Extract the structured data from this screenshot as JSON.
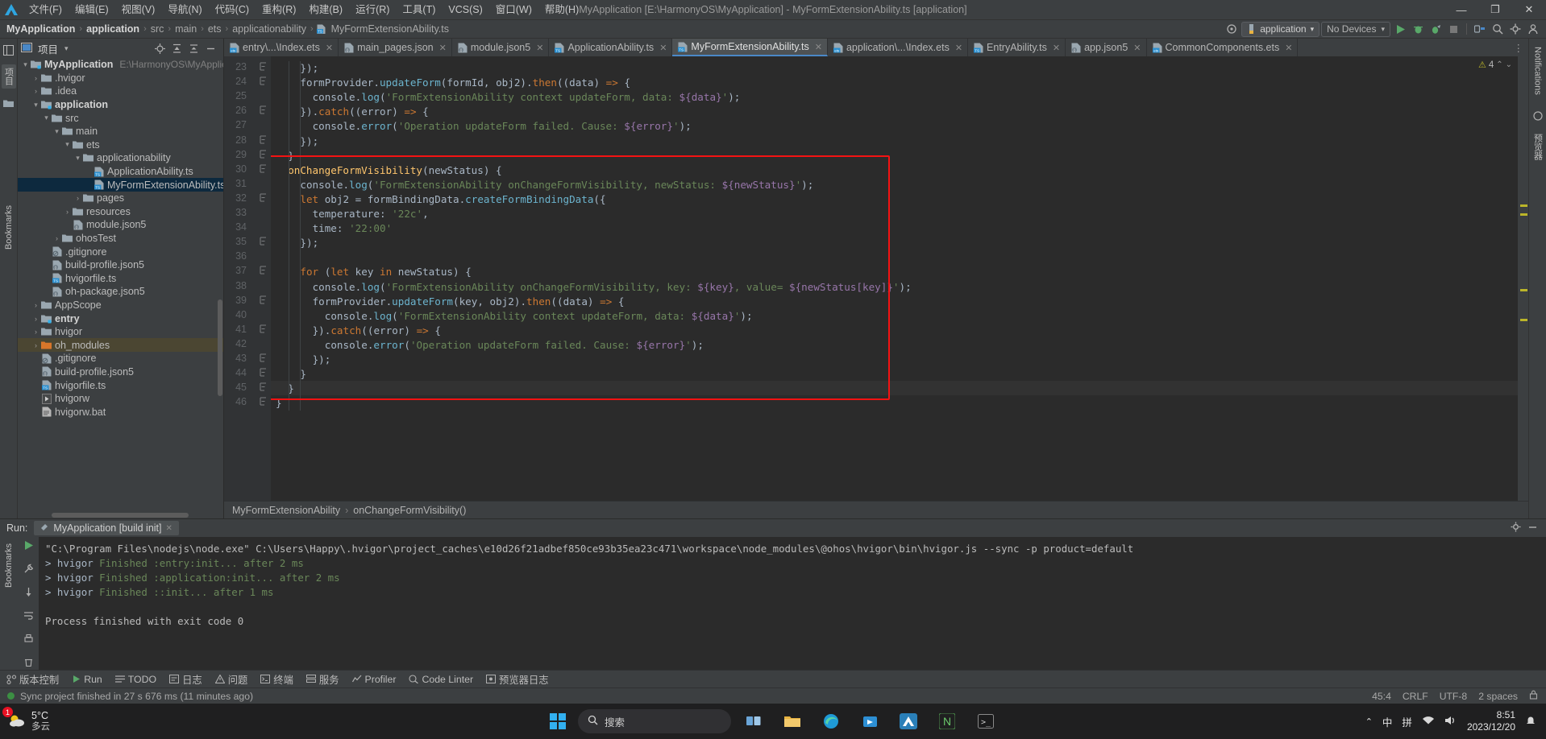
{
  "window": {
    "title": "MyApplication [E:\\HarmonyOS\\MyApplication] - MyFormExtensionAbility.ts [application]",
    "minimize": "—",
    "maximize": "❐",
    "close": "✕"
  },
  "menubar": {
    "items": [
      {
        "label": "文件(F)",
        "name": "menu-file"
      },
      {
        "label": "编辑(E)",
        "name": "menu-edit"
      },
      {
        "label": "视图(V)",
        "name": "menu-view"
      },
      {
        "label": "导航(N)",
        "name": "menu-navigate"
      },
      {
        "label": "代码(C)",
        "name": "menu-code"
      },
      {
        "label": "重构(R)",
        "name": "menu-refactor"
      },
      {
        "label": "构建(B)",
        "name": "menu-build"
      },
      {
        "label": "运行(R)",
        "name": "menu-run"
      },
      {
        "label": "工具(T)",
        "name": "menu-tools"
      },
      {
        "label": "VCS(S)",
        "name": "menu-vcs"
      },
      {
        "label": "窗口(W)",
        "name": "menu-window"
      },
      {
        "label": "帮助(H)",
        "name": "menu-help"
      }
    ]
  },
  "breadcrumb": {
    "items": [
      "MyApplication",
      "application",
      "src",
      "main",
      "ets",
      "applicationability",
      "MyFormExtensionAbility.ts"
    ],
    "separator": "›"
  },
  "navbar": {
    "run_config": "application",
    "device_selector": "No Devices",
    "caret_down": "▾"
  },
  "project_panel": {
    "title": "项目",
    "dropdown_caret": "▾",
    "tree": [
      {
        "depth": 0,
        "twisty": "▾",
        "icon": "module-folder",
        "label": "MyApplication",
        "bold": true,
        "path": "E:\\HarmonyOS\\MyApplication"
      },
      {
        "depth": 1,
        "twisty": "›",
        "icon": "folder",
        "label": ".hvigor"
      },
      {
        "depth": 1,
        "twisty": "›",
        "icon": "folder",
        "label": ".idea"
      },
      {
        "depth": 1,
        "twisty": "▾",
        "icon": "module-folder",
        "label": "application",
        "bold": true
      },
      {
        "depth": 2,
        "twisty": "▾",
        "icon": "folder",
        "label": "src"
      },
      {
        "depth": 3,
        "twisty": "▾",
        "icon": "folder",
        "label": "main"
      },
      {
        "depth": 4,
        "twisty": "▾",
        "icon": "folder",
        "label": "ets"
      },
      {
        "depth": 5,
        "twisty": "▾",
        "icon": "folder",
        "label": "applicationability"
      },
      {
        "depth": 6,
        "twisty": "",
        "icon": "ts-file",
        "label": "ApplicationAbility.ts"
      },
      {
        "depth": 6,
        "twisty": "",
        "icon": "ts-file",
        "label": "MyFormExtensionAbility.ts",
        "selected": true
      },
      {
        "depth": 5,
        "twisty": "›",
        "icon": "folder",
        "label": "pages"
      },
      {
        "depth": 4,
        "twisty": "›",
        "icon": "folder",
        "label": "resources"
      },
      {
        "depth": 4,
        "twisty": "",
        "icon": "json-file",
        "label": "module.json5"
      },
      {
        "depth": 3,
        "twisty": "›",
        "icon": "folder",
        "label": "ohosTest"
      },
      {
        "depth": 2,
        "twisty": "",
        "icon": "gitignore-file",
        "label": ".gitignore"
      },
      {
        "depth": 2,
        "twisty": "",
        "icon": "json-file",
        "label": "build-profile.json5"
      },
      {
        "depth": 2,
        "twisty": "",
        "icon": "ts-file",
        "label": "hvigorfile.ts"
      },
      {
        "depth": 2,
        "twisty": "",
        "icon": "json-file",
        "label": "oh-package.json5"
      },
      {
        "depth": 1,
        "twisty": "›",
        "icon": "folder",
        "label": "AppScope"
      },
      {
        "depth": 1,
        "twisty": "›",
        "icon": "module-folder",
        "label": "entry",
        "bold": true
      },
      {
        "depth": 1,
        "twisty": "›",
        "icon": "folder",
        "label": "hvigor"
      },
      {
        "depth": 1,
        "twisty": "›",
        "icon": "folder-orange",
        "label": "oh_modules",
        "highlight": true
      },
      {
        "depth": 1,
        "twisty": "",
        "icon": "gitignore-file",
        "label": ".gitignore"
      },
      {
        "depth": 1,
        "twisty": "",
        "icon": "json-file",
        "label": "build-profile.json5"
      },
      {
        "depth": 1,
        "twisty": "",
        "icon": "ts-file",
        "label": "hvigorfile.ts"
      },
      {
        "depth": 1,
        "twisty": "",
        "icon": "script-file",
        "label": "hvigorw"
      },
      {
        "depth": 1,
        "twisty": "",
        "icon": "bat-file",
        "label": "hvigorw.bat"
      }
    ]
  },
  "left_strip": {
    "project_tab": "项目",
    "structure_icon": "structure-icon",
    "folder_icon": "folder-icon",
    "bookmarks_tab": "Bookmarks"
  },
  "right_strip": {
    "notifications_tab": "Notifications",
    "preview_tab": "预览器"
  },
  "editor_tabs": [
    {
      "label": "entry\\...\\Index.ets",
      "icon": "ets-file",
      "active": false
    },
    {
      "label": "main_pages.json",
      "icon": "json-file",
      "active": false
    },
    {
      "label": "module.json5",
      "icon": "json-file",
      "active": false
    },
    {
      "label": "ApplicationAbility.ts",
      "icon": "ts-file",
      "active": false
    },
    {
      "label": "MyFormExtensionAbility.ts",
      "icon": "ts-file",
      "active": true
    },
    {
      "label": "application\\...\\Index.ets",
      "icon": "ets-file",
      "active": false
    },
    {
      "label": "EntryAbility.ts",
      "icon": "ts-file",
      "active": false
    },
    {
      "label": "app.json5",
      "icon": "json-file",
      "active": false
    },
    {
      "label": "CommonComponents.ets",
      "icon": "ets-file",
      "active": false
    }
  ],
  "editor": {
    "warning_count": "4",
    "warning_icon": "warning-triangle-icon",
    "first_line_number": 23,
    "lines": [
      {
        "n": 23,
        "fold": "minus",
        "text": "    });"
      },
      {
        "n": 24,
        "fold": "minus",
        "text": "    formProvider.updateForm(formId, obj2).then((data) => {"
      },
      {
        "n": 25,
        "fold": "",
        "text": "      console.log('FormExtensionAbility context updateForm, data: ${data}');"
      },
      {
        "n": 26,
        "fold": "minus",
        "text": "    }).catch((error) => {"
      },
      {
        "n": 27,
        "fold": "",
        "text": "      console.error('Operation updateForm failed. Cause: ${error}');"
      },
      {
        "n": 28,
        "fold": "minus",
        "text": "    });"
      },
      {
        "n": 29,
        "fold": "minus",
        "text": "  }"
      },
      {
        "n": 30,
        "fold": "minus",
        "text": "  onChangeFormVisibility(newStatus) {"
      },
      {
        "n": 31,
        "fold": "",
        "text": "    console.log('FormExtensionAbility onChangeFormVisibility, newStatus: ${newStatus}');"
      },
      {
        "n": 32,
        "fold": "minus",
        "text": "    let obj2 = formBindingData.createFormBindingData({"
      },
      {
        "n": 33,
        "fold": "",
        "text": "      temperature: '22c',"
      },
      {
        "n": 34,
        "fold": "",
        "text": "      time: '22:00'"
      },
      {
        "n": 35,
        "fold": "minus",
        "text": "    });"
      },
      {
        "n": 36,
        "fold": "",
        "text": ""
      },
      {
        "n": 37,
        "fold": "minus",
        "text": "    for (let key in newStatus) {"
      },
      {
        "n": 38,
        "fold": "",
        "text": "      console.log('FormExtensionAbility onChangeFormVisibility, key: ${key}, value= ${newStatus[key]}');"
      },
      {
        "n": 39,
        "fold": "minus",
        "text": "      formProvider.updateForm(key, obj2).then((data) => {"
      },
      {
        "n": 40,
        "fold": "",
        "text": "        console.log('FormExtensionAbility context updateForm, data: ${data}');"
      },
      {
        "n": 41,
        "fold": "minus",
        "text": "      }).catch((error) => {"
      },
      {
        "n": 42,
        "fold": "",
        "text": "        console.error('Operation updateForm failed. Cause: ${error}');"
      },
      {
        "n": 43,
        "fold": "minus",
        "text": "      });"
      },
      {
        "n": 44,
        "fold": "minus",
        "text": "    }",
        "bulb": true
      },
      {
        "n": 45,
        "fold": "minus",
        "text": "  }"
      },
      {
        "n": 46,
        "fold": "minus",
        "text": "}"
      }
    ]
  },
  "editor_breadcrumb": {
    "class": "MyFormExtensionAbility",
    "separator": "›",
    "method": "onChangeFormVisibility()"
  },
  "run_panel": {
    "label": "Run:",
    "tab_label": "MyApplication [build init]",
    "tab_close": "✕",
    "settings_icon": "gear-icon",
    "minimize_icon": "minimize-icon",
    "console_lines": [
      {
        "text": "\"C:\\Program Files\\nodejs\\node.exe\" C:\\Users\\Happy\\.hvigor\\project_caches\\e10d26f21adbef850ce93b35ea23c471\\workspace\\node_modules\\@ohos\\hvigor\\bin\\hvigor.js --sync -p product=default",
        "style": "plain"
      },
      {
        "text": "> hvigor Finished :entry:init... after 2 ms",
        "style": "green"
      },
      {
        "text": "> hvigor Finished :application:init... after 2 ms",
        "style": "green"
      },
      {
        "text": "> hvigor Finished ::init... after 1 ms",
        "style": "green"
      },
      {
        "text": "",
        "style": "plain"
      },
      {
        "text": "Process finished with exit code 0",
        "style": "plain"
      }
    ]
  },
  "tool_window_bar": {
    "items": [
      {
        "label": "版本控制",
        "icon": "vcs-icon"
      },
      {
        "label": "Run",
        "icon": "run-icon"
      },
      {
        "label": "TODO",
        "icon": "todo-icon"
      },
      {
        "label": "日志",
        "icon": "log-icon"
      },
      {
        "label": "问题",
        "icon": "problems-icon"
      },
      {
        "label": "终端",
        "icon": "terminal-icon"
      },
      {
        "label": "服务",
        "icon": "services-icon"
      },
      {
        "label": "Profiler",
        "icon": "profiler-icon"
      },
      {
        "label": "Code Linter",
        "icon": "linter-icon"
      },
      {
        "label": "预览器日志",
        "icon": "previewer-log-icon"
      }
    ]
  },
  "status_bar": {
    "message": "Sync project finished in 27 s 676 ms (11 minutes ago)",
    "caret_position": "45:4",
    "line_sep": "CRLF",
    "encoding": "UTF-8",
    "indent": "2 spaces",
    "lock_icon": "lock-icon",
    "sync_icon": "sync-status-icon"
  },
  "taskbar": {
    "weather_temp": "5°C",
    "weather_desc": "多云",
    "search_placeholder": "搜索",
    "start_icon": "windows-start-icon",
    "apps": [
      {
        "name": "task-view-icon"
      },
      {
        "name": "file-explorer-icon"
      },
      {
        "name": "edge-icon"
      },
      {
        "name": "store-icon"
      },
      {
        "name": "devecostudio-icon"
      },
      {
        "name": "app-n-icon"
      },
      {
        "name": "terminal-icon"
      }
    ],
    "tray": {
      "chevron": "⌃",
      "ime": "中",
      "pinyin": "拼",
      "network_icon": "network-icon",
      "volume_icon": "volume-icon"
    },
    "clock_time": "8:51",
    "clock_date": "2023/12/20",
    "notification_badge": "1"
  },
  "colors": {
    "accent": "#4a88c7",
    "red_box": "#f41212",
    "selection": "#0d293e",
    "string": "#6a8759",
    "keyword": "#cc7832",
    "function": "#ffc66d",
    "method": "#6cb4ce",
    "template": "#9876aa",
    "console_green": "#6a8759",
    "warning": "#bbb529"
  }
}
